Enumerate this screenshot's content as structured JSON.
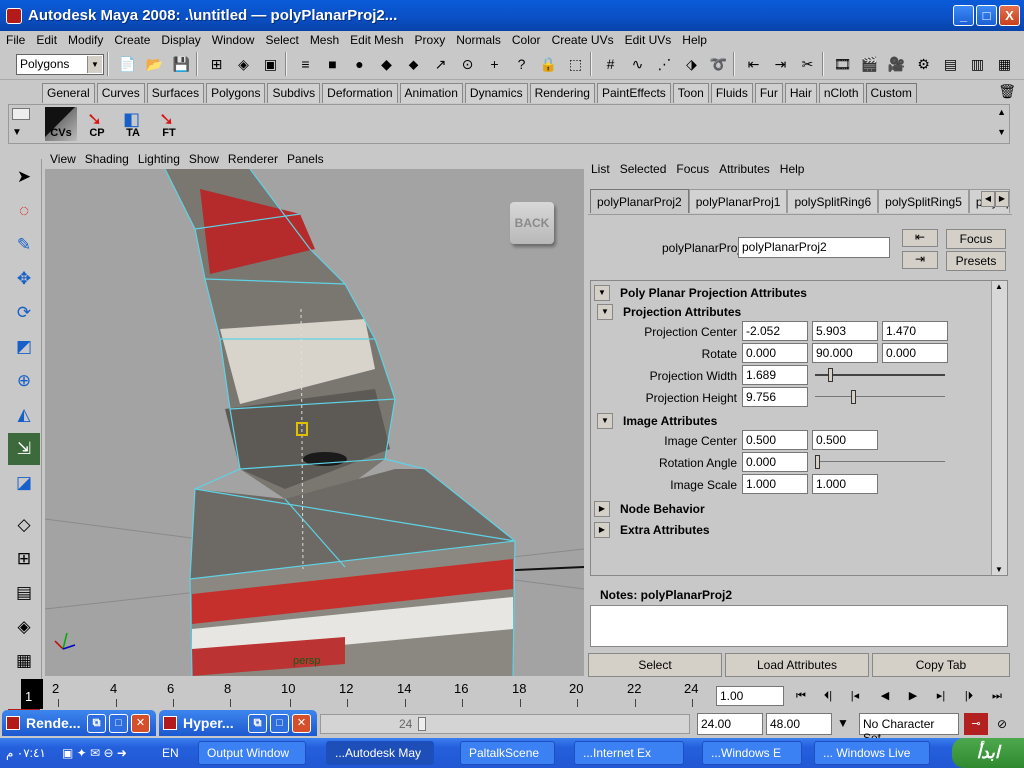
{
  "window": {
    "title": "Autodesk Maya 2008: .\\untitled  —  polyPlanarProj2...",
    "minimize": "_",
    "maximize": "□",
    "close": "X"
  },
  "menubar": [
    "File",
    "Edit",
    "Modify",
    "Create",
    "Display",
    "Window",
    "Select",
    "Mesh",
    "Edit Mesh",
    "Proxy",
    "Normals",
    "Color",
    "Create UVs",
    "Edit UVs",
    "Help"
  ],
  "status_line": {
    "mode": "Polygons"
  },
  "shelf_tabs": [
    "General",
    "Curves",
    "Surfaces",
    "Polygons",
    "Subdivs",
    "Deformation",
    "Animation",
    "Dynamics",
    "Rendering",
    "PaintEffects",
    "Toon",
    "Fluids",
    "Fur",
    "Hair",
    "nCloth",
    "Custom"
  ],
  "shelf_active": "Custom",
  "shelf_buttons": [
    "CVs",
    "CP",
    "TA",
    "FT"
  ],
  "viewport": {
    "menu": [
      "View",
      "Shading",
      "Lighting",
      "Show",
      "Renderer",
      "Panels"
    ],
    "back_label": "BACK",
    "camera_label": "persp"
  },
  "attribute_editor": {
    "menu": [
      "List",
      "Selected",
      "Focus",
      "Attributes",
      "Help"
    ],
    "tabs": [
      "polyPlanarProj2",
      "polyPlanarProj1",
      "polySplitRing6",
      "polySplitRing5",
      "polySplitRi"
    ],
    "node_label": "polyPlanarProj:",
    "node_value": "polyPlanarProj2",
    "focus_label": "Focus",
    "presets_label": "Presets",
    "main_section": "Poly Planar Projection Attributes",
    "projection_section": "Projection Attributes",
    "projection_center_label": "Projection Center",
    "projection_center": [
      "-2.052",
      "5.903",
      "1.470"
    ],
    "rotate_label": "Rotate",
    "rotate": [
      "0.000",
      "90.000",
      "0.000"
    ],
    "projection_width_label": "Projection Width",
    "projection_width": "1.689",
    "projection_height_label": "Projection Height",
    "projection_height": "9.756",
    "image_section": "Image Attributes",
    "image_center_label": "Image Center",
    "image_center": [
      "0.500",
      "0.500"
    ],
    "rotation_angle_label": "Rotation Angle",
    "rotation_angle": "0.000",
    "image_scale_label": "Image Scale",
    "image_scale": [
      "1.000",
      "1.000"
    ],
    "node_behavior": "Node Behavior",
    "extra_attributes": "Extra Attributes",
    "notes_label": "Notes:  polyPlanarProj2",
    "select_btn": "Select",
    "load_btn": "Load Attributes",
    "copy_btn": "Copy Tab"
  },
  "time_slider": {
    "ticks": [
      "2",
      "4",
      "6",
      "8",
      "10",
      "12",
      "14",
      "16",
      "18",
      "20",
      "22",
      "24"
    ],
    "current_frame": "1",
    "frame_field": "1.00"
  },
  "range_slider": {
    "range_end": "24",
    "end_time": "24.00",
    "max_time": "48.00",
    "character_set": "No Character Set"
  },
  "floating_windows": [
    "Rende...",
    "Hyper..."
  ],
  "taskbar": {
    "tasks": [
      "Output Window",
      "...Autodesk May",
      "PaltalkScene",
      "...Internet Ex",
      "...Windows E",
      "... Windows Live"
    ],
    "clock": "٠٧:٤١ م",
    "lang": "EN",
    "start_label": "ابدأ"
  }
}
